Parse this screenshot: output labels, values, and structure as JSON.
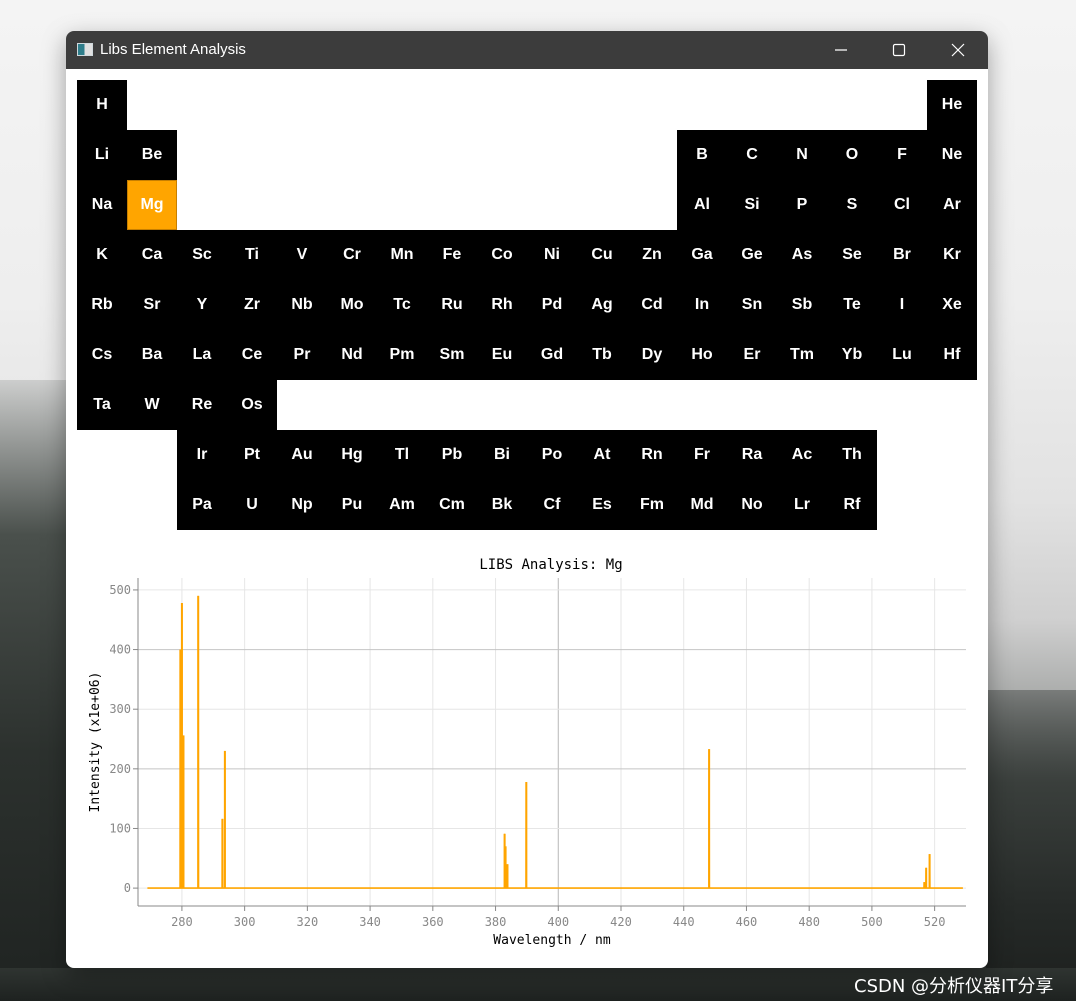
{
  "window": {
    "title": "Libs Element Analysis",
    "controls": {
      "minimize": "minimize-icon",
      "maximize": "maximize-icon",
      "close": "close-icon"
    }
  },
  "periodic_table": {
    "selected": "Mg",
    "selected_color": "#ffa500",
    "cell_color": "#000000",
    "rows": [
      [
        "H",
        null,
        null,
        null,
        null,
        null,
        null,
        null,
        null,
        null,
        null,
        null,
        null,
        null,
        null,
        null,
        null,
        "He"
      ],
      [
        "Li",
        "Be",
        null,
        null,
        null,
        null,
        null,
        null,
        null,
        null,
        null,
        null,
        "B",
        "C",
        "N",
        "O",
        "F",
        "Ne"
      ],
      [
        "Na",
        "Mg",
        null,
        null,
        null,
        null,
        null,
        null,
        null,
        null,
        null,
        null,
        "Al",
        "Si",
        "P",
        "S",
        "Cl",
        "Ar"
      ],
      [
        "K",
        "Ca",
        "Sc",
        "Ti",
        "V",
        "Cr",
        "Mn",
        "Fe",
        "Co",
        "Ni",
        "Cu",
        "Zn",
        "Ga",
        "Ge",
        "As",
        "Se",
        "Br",
        "Kr"
      ],
      [
        "Rb",
        "Sr",
        "Y",
        "Zr",
        "Nb",
        "Mo",
        "Tc",
        "Ru",
        "Rh",
        "Pd",
        "Ag",
        "Cd",
        "In",
        "Sn",
        "Sb",
        "Te",
        "I",
        "Xe"
      ],
      [
        "Cs",
        "Ba",
        "La",
        "Ce",
        "Pr",
        "Nd",
        "Pm",
        "Sm",
        "Eu",
        "Gd",
        "Tb",
        "Dy",
        "Ho",
        "Er",
        "Tm",
        "Yb",
        "Lu",
        "Hf"
      ],
      [
        "Ta",
        "W",
        "Re",
        "Os",
        null,
        null,
        null,
        null,
        null,
        null,
        null,
        null,
        null,
        null,
        null,
        null,
        null,
        null
      ],
      [
        null,
        null,
        "Ir",
        "Pt",
        "Au",
        "Hg",
        "Tl",
        "Pb",
        "Bi",
        "Po",
        "At",
        "Rn",
        "Fr",
        "Ra",
        "Ac",
        "Th",
        null,
        null
      ],
      [
        null,
        null,
        "Pa",
        "U",
        "Np",
        "Pu",
        "Am",
        "Cm",
        "Bk",
        "Cf",
        "Es",
        "Fm",
        "Md",
        "No",
        "Lr",
        "Rf",
        null,
        null
      ]
    ]
  },
  "chart_data": {
    "type": "line",
    "title": "LIBS Analysis: Mg",
    "xlabel": "Wavelength / nm",
    "ylabel": "Intensity (x1e+06)",
    "xlim": [
      266,
      530
    ],
    "ylim": [
      -30,
      520
    ],
    "xticks": [
      280,
      300,
      320,
      340,
      360,
      380,
      400,
      420,
      440,
      460,
      480,
      500,
      520
    ],
    "yticks": [
      0,
      100,
      200,
      300,
      400,
      500
    ],
    "grid": true,
    "series": [
      {
        "color": "#ffa500",
        "range": [
          269,
          529
        ],
        "peaks": [
          {
            "x": 279.5,
            "y": 400
          },
          {
            "x": 280.0,
            "y": 478
          },
          {
            "x": 280.5,
            "y": 256
          },
          {
            "x": 285.2,
            "y": 490
          },
          {
            "x": 292.9,
            "y": 116
          },
          {
            "x": 293.7,
            "y": 230
          },
          {
            "x": 382.9,
            "y": 91
          },
          {
            "x": 383.2,
            "y": 70
          },
          {
            "x": 383.8,
            "y": 40
          },
          {
            "x": 389.8,
            "y": 178
          },
          {
            "x": 448.1,
            "y": 233
          },
          {
            "x": 516.7,
            "y": 10
          },
          {
            "x": 517.3,
            "y": 34
          },
          {
            "x": 518.4,
            "y": 57
          }
        ]
      }
    ]
  },
  "watermark": "CSDN @分析仪器IT分享"
}
